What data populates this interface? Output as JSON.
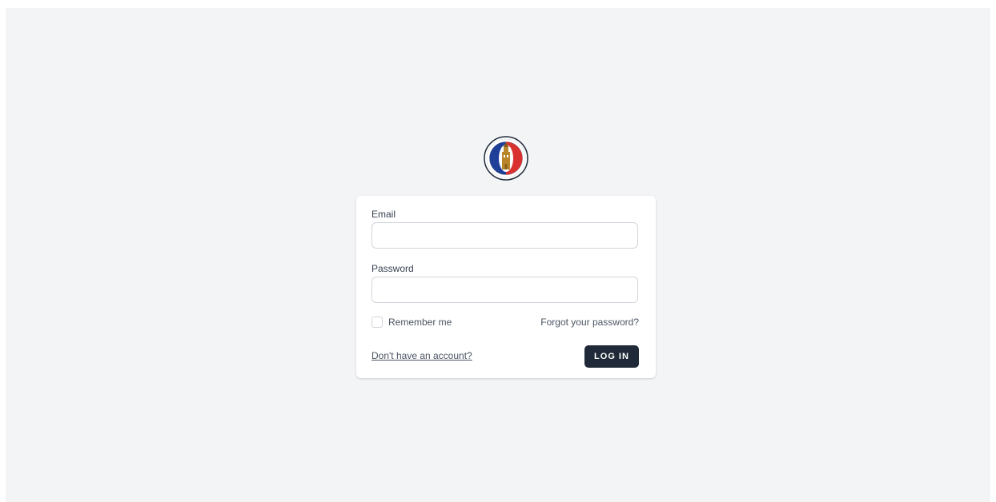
{
  "form": {
    "email_label": "Email",
    "email_value": "",
    "password_label": "Password",
    "password_value": "",
    "remember_label": "Remember me",
    "forgot_label": "Forgot your password?",
    "register_label": "Don't have an account?",
    "login_label": "LOG IN"
  },
  "colors": {
    "background": "#f3f4f6",
    "button": "#1f2937",
    "logo_blue": "#1f3f99",
    "logo_red": "#d93030",
    "logo_gold": "#b8862b"
  },
  "icons": {
    "logo": "city-seal-logo"
  }
}
